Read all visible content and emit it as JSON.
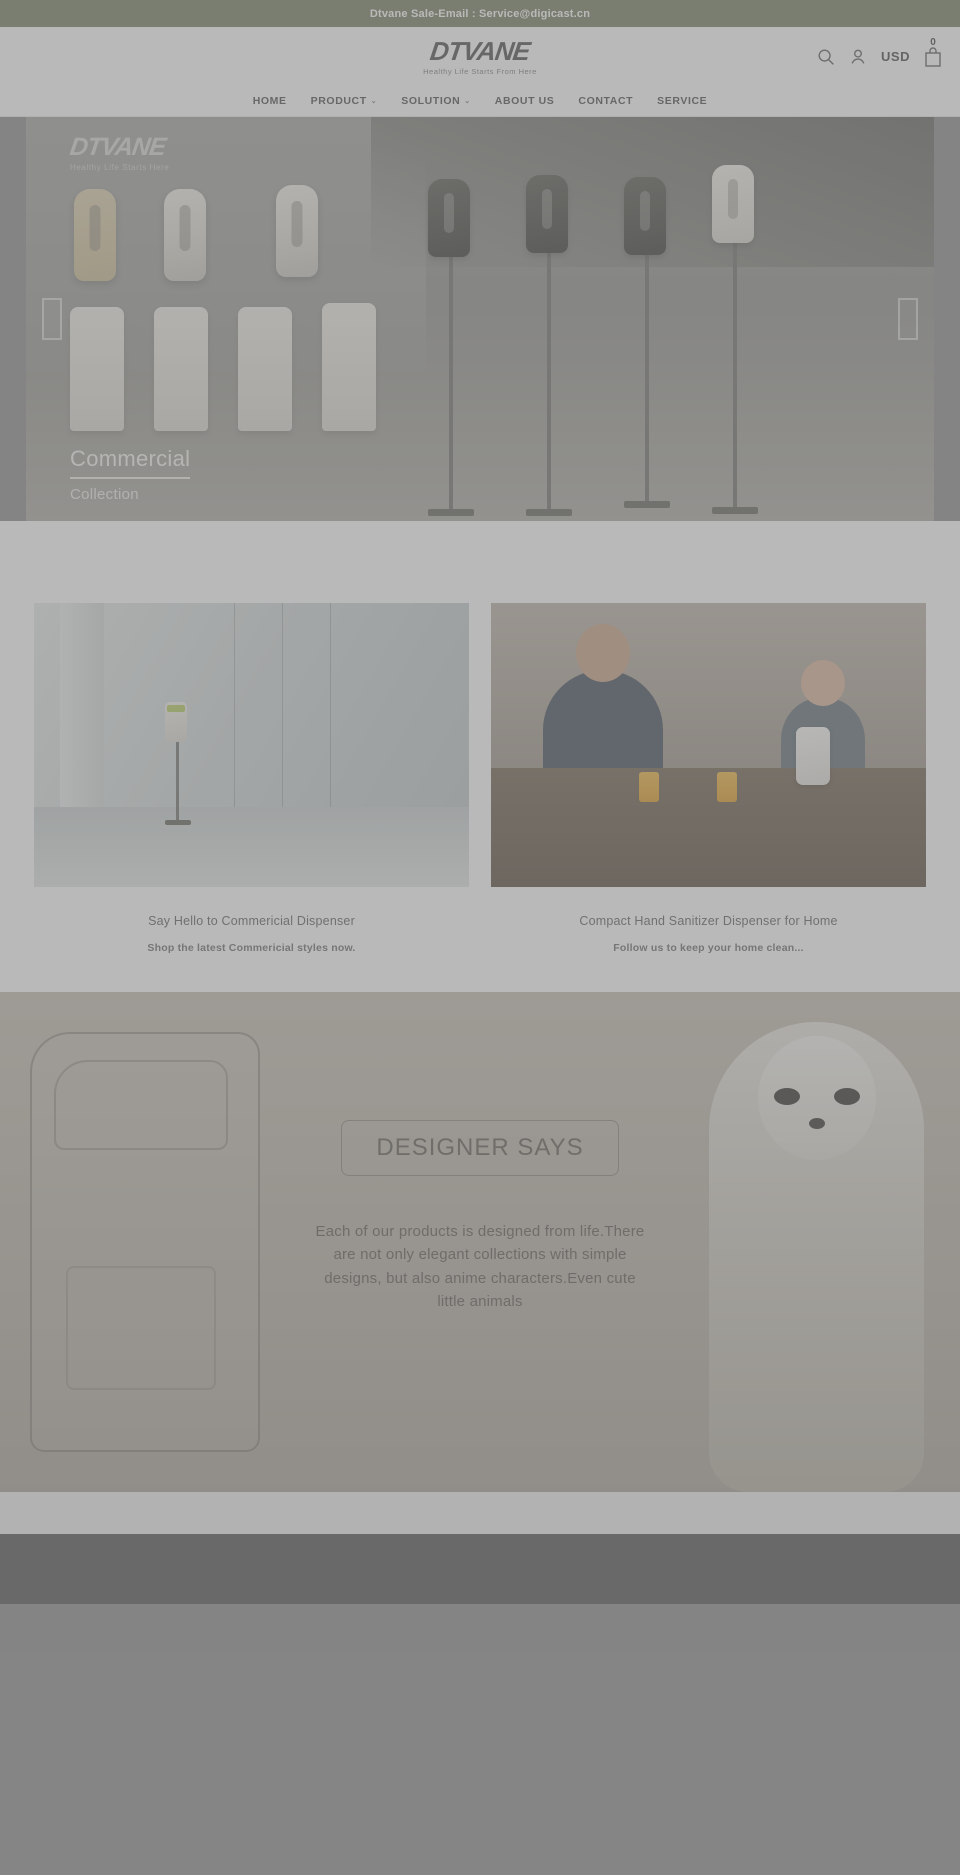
{
  "announcement": {
    "text": "Dtvane Sale-Email : Service@digicast.cn"
  },
  "header": {
    "logo_word": "DTVANE",
    "logo_tagline": "Healthy Life Starts From Here",
    "search_icon": "search-icon",
    "account_icon": "account-icon",
    "currency": "USD",
    "cart_icon": "cart-icon",
    "cart_count": "0"
  },
  "nav": {
    "items": [
      {
        "label": "HOME",
        "caret": ""
      },
      {
        "label": "PRODUCT",
        "caret": "⌄"
      },
      {
        "label": "SOLUTION",
        "caret": "⌄"
      },
      {
        "label": "ABOUT US",
        "caret": ""
      },
      {
        "label": "CONTACT",
        "caret": ""
      },
      {
        "label": "SERVICE",
        "caret": ""
      }
    ]
  },
  "hero": {
    "watermark_word": "DTVANE",
    "watermark_tagline": "Healthy Life Starts Here",
    "caption_main": "Commercial",
    "caption_sub": "Collection",
    "prev_label": "‹",
    "next_label": "›"
  },
  "promos": [
    {
      "title": "Say Hello to Commericial Dispenser",
      "subtitle": "Shop the latest Commericial styles now."
    },
    {
      "title": "Compact Hand Sanitizer Dispenser for Home",
      "subtitle": "Follow us to keep your home clean..."
    }
  ],
  "designer": {
    "badge": "DESIGNER SAYS",
    "paragraph": "Each of our products is designed from life.There are not only elegant collections with simple designs, but also anime characters.Even cute little animals"
  },
  "colors": {
    "announcement_bg": "#737c5e",
    "accent_green": "#b6cc5c",
    "text_dark": "#4b4b4b",
    "footer_dark": "#4f4f4f"
  }
}
